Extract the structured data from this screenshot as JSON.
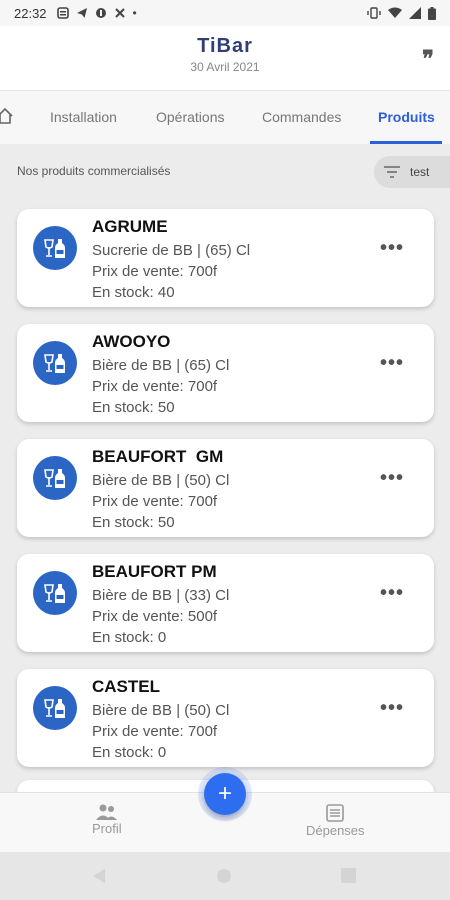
{
  "status_bar": {
    "time": "22:32",
    "dot": "•"
  },
  "header": {
    "title": "TiBar",
    "date": "30 Avril 2021",
    "quote_glyph": "❞"
  },
  "tabs": [
    {
      "label": "Installation"
    },
    {
      "label": "Opérations"
    },
    {
      "label": "Commandes"
    },
    {
      "label": "Produits",
      "active": true
    }
  ],
  "section": {
    "title": "Nos produits commercialisés",
    "filter_label": "test"
  },
  "products": [
    {
      "name": "AGRUME",
      "type": "Sucrerie de BB | (65) Cl",
      "price": "Prix de vente: 700f",
      "stock": "En stock: 40"
    },
    {
      "name": "AWOOYO",
      "type": "Bière de BB | (65) Cl",
      "price": "Prix de vente: 700f",
      "stock": "En stock: 50"
    },
    {
      "name": "BEAUFORT  GM",
      "type": "Bière de BB | (50) Cl",
      "price": "Prix de vente: 700f",
      "stock": "En stock: 50"
    },
    {
      "name": "BEAUFORT PM",
      "type": "Bière de BB | (33) Cl",
      "price": "Prix de vente: 500f",
      "stock": "En stock: 0"
    },
    {
      "name": "CASTEL",
      "type": "Bière de BB | (50) Cl",
      "price": "Prix de vente: 700f",
      "stock": "En stock: 0"
    }
  ],
  "more_glyph": "•••",
  "fab_glyph": "+",
  "bottom_nav": {
    "profil": "Profil",
    "depenses": "Dépenses"
  },
  "colors": {
    "accent": "#2c5fd8",
    "title": "#2f3e79",
    "avatar": "#2c66c4",
    "fab": "#2d6ef0"
  }
}
